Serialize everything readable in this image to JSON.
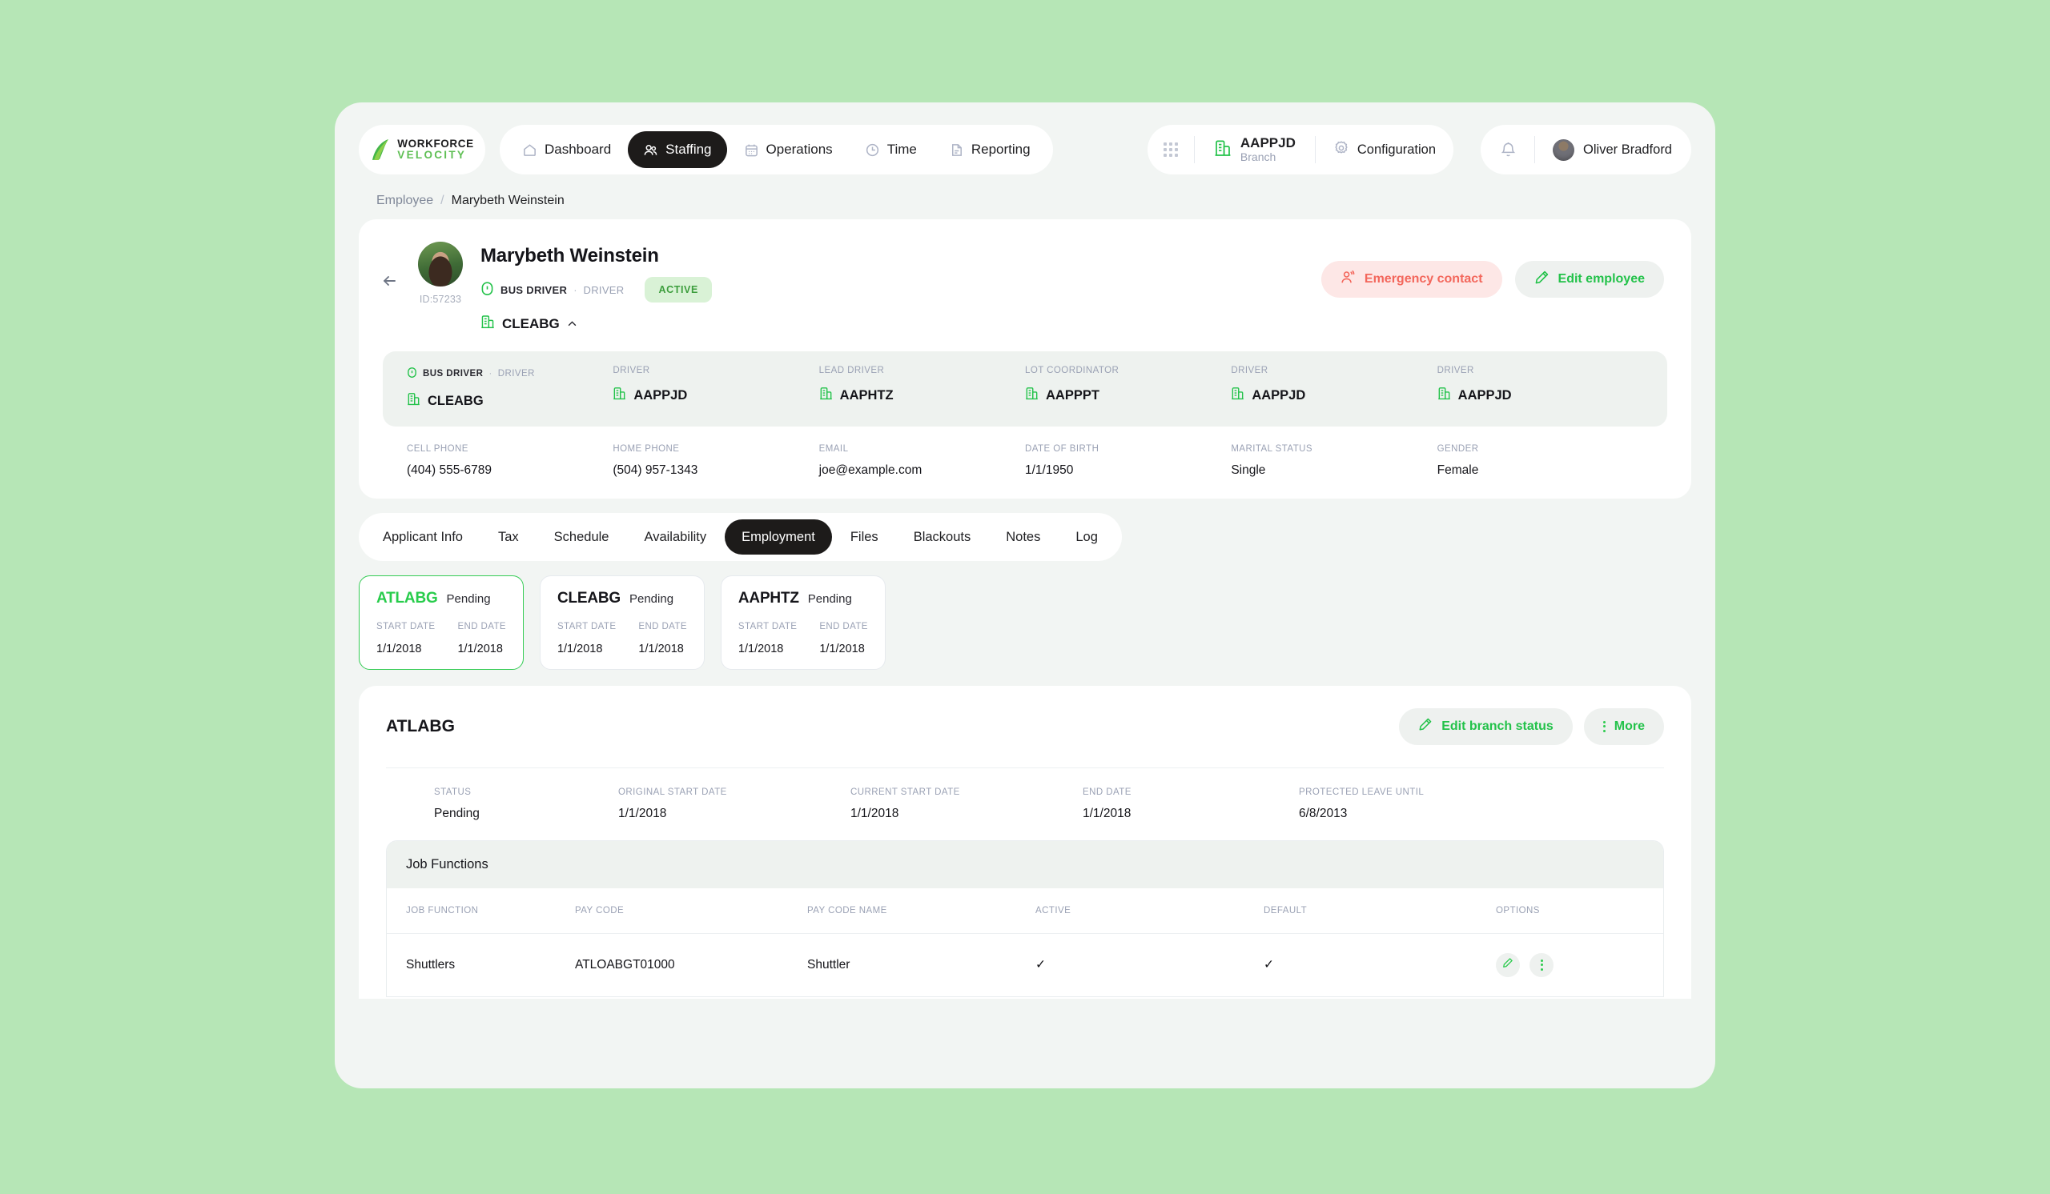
{
  "brand": {
    "line1": "WORKFORCE",
    "line2": "VELOCITY",
    "accent": "#23c24a",
    "logo_icon": "leaf-swoosh-icon"
  },
  "nav": {
    "items": [
      {
        "label": "Dashboard",
        "icon": "home-icon",
        "active": false
      },
      {
        "label": "Staffing",
        "icon": "people-icon",
        "active": true
      },
      {
        "label": "Operations",
        "icon": "calendar-icon",
        "active": false
      },
      {
        "label": "Time",
        "icon": "clock-icon",
        "active": false
      },
      {
        "label": "Reporting",
        "icon": "document-icon",
        "active": false
      }
    ]
  },
  "branch_selector": {
    "name": "AAPPJD",
    "label": "Branch",
    "icon": "building-icon"
  },
  "configuration": {
    "label": "Configuration",
    "icon": "gear-icon"
  },
  "account": {
    "user_name": "Oliver Bradford",
    "bell_icon": "bell-icon",
    "avatar": "user-avatar"
  },
  "breadcrumb": {
    "root": "Employee",
    "separator": "/",
    "current": "Marybeth Weinstein"
  },
  "employee": {
    "name": "Marybeth Weinstein",
    "id": "ID:57233",
    "role_main": "BUS DRIVER",
    "role_dot": "·",
    "role_sub": "DRIVER",
    "status": "ACTIVE",
    "branch": "CLEABG",
    "emergency_button": "Emergency contact",
    "edit_button": "Edit employee"
  },
  "role_strip": [
    {
      "label_main": "BUS DRIVER",
      "label_dot": "·",
      "label_sub": "DRIVER",
      "value": "CLEABG",
      "primary": true
    },
    {
      "label_main": "",
      "label_dot": "",
      "label_sub": "DRIVER",
      "value": "AAPPJD",
      "primary": false
    },
    {
      "label_main": "",
      "label_dot": "",
      "label_sub": "LEAD DRIVER",
      "value": "AAPHTZ",
      "primary": false
    },
    {
      "label_main": "",
      "label_dot": "",
      "label_sub": "LOT COORDINATOR",
      "value": "AAPPPT",
      "primary": false
    },
    {
      "label_main": "",
      "label_dot": "",
      "label_sub": "DRIVER",
      "value": "AAPPJD",
      "primary": false
    },
    {
      "label_main": "",
      "label_dot": "",
      "label_sub": "DRIVER",
      "value": "AAPPJD",
      "primary": false
    }
  ],
  "contact": [
    {
      "label": "CELL PHONE",
      "value": "(404) 555-6789"
    },
    {
      "label": "HOME PHONE",
      "value": "(504) 957-1343"
    },
    {
      "label": "EMAIL",
      "value": "joe@example.com"
    },
    {
      "label": "DATE OF BIRTH",
      "value": "1/1/1950"
    },
    {
      "label": "MARITAL STATUS",
      "value": "Single"
    },
    {
      "label": "GENDER",
      "value": "Female"
    }
  ],
  "tabs": [
    {
      "label": "Applicant Info",
      "active": false
    },
    {
      "label": "Tax",
      "active": false
    },
    {
      "label": "Schedule",
      "active": false
    },
    {
      "label": "Availability",
      "active": false
    },
    {
      "label": "Employment",
      "active": true
    },
    {
      "label": "Files",
      "active": false
    },
    {
      "label": "Blackouts",
      "active": false
    },
    {
      "label": "Notes",
      "active": false
    },
    {
      "label": "Log",
      "active": false
    }
  ],
  "branch_cards": [
    {
      "code": "ATLABG",
      "status": "Pending",
      "start_label": "START DATE",
      "end_label": "END DATE",
      "start_date": "1/1/2018",
      "end_date": "1/1/2018",
      "selected": true
    },
    {
      "code": "CLEABG",
      "status": "Pending",
      "start_label": "START DATE",
      "end_label": "END DATE",
      "start_date": "1/1/2018",
      "end_date": "1/1/2018",
      "selected": false
    },
    {
      "code": "AAPHTZ",
      "status": "Pending",
      "start_label": "START DATE",
      "end_label": "END DATE",
      "start_date": "1/1/2018",
      "end_date": "1/1/2018",
      "selected": false
    }
  ],
  "detail": {
    "title": "ATLABG",
    "edit_branch_status": "Edit branch status",
    "more": "More",
    "meta": [
      {
        "label": "STATUS",
        "value": "Pending"
      },
      {
        "label": "ORIGINAL START DATE",
        "value": "1/1/2018"
      },
      {
        "label": "CURRENT START DATE",
        "value": "1/1/2018"
      },
      {
        "label": "END DATE",
        "value": "1/1/2018"
      },
      {
        "label": "PROTECTED LEAVE UNTIL",
        "value": "6/8/2013"
      }
    ],
    "job_functions": {
      "section_title": "Job Functions",
      "columns": [
        "JOB FUNCTION",
        "PAY CODE",
        "PAY CODE NAME",
        "ACTIVE",
        "DEFAULT",
        "OPTIONS"
      ],
      "rows": [
        {
          "job_function": "Shuttlers",
          "pay_code": "ATLOABGT01000",
          "pay_code_name": "Shuttler",
          "active": "✓",
          "default": "✓"
        }
      ]
    }
  },
  "colors": {
    "page_background": "#b6e6b6",
    "app_background": "#f2f5f3",
    "accent_green": "#23c24a",
    "status_green": "#3d9e3d",
    "danger_red": "#f3675c",
    "dark": "#1d1b1a"
  }
}
